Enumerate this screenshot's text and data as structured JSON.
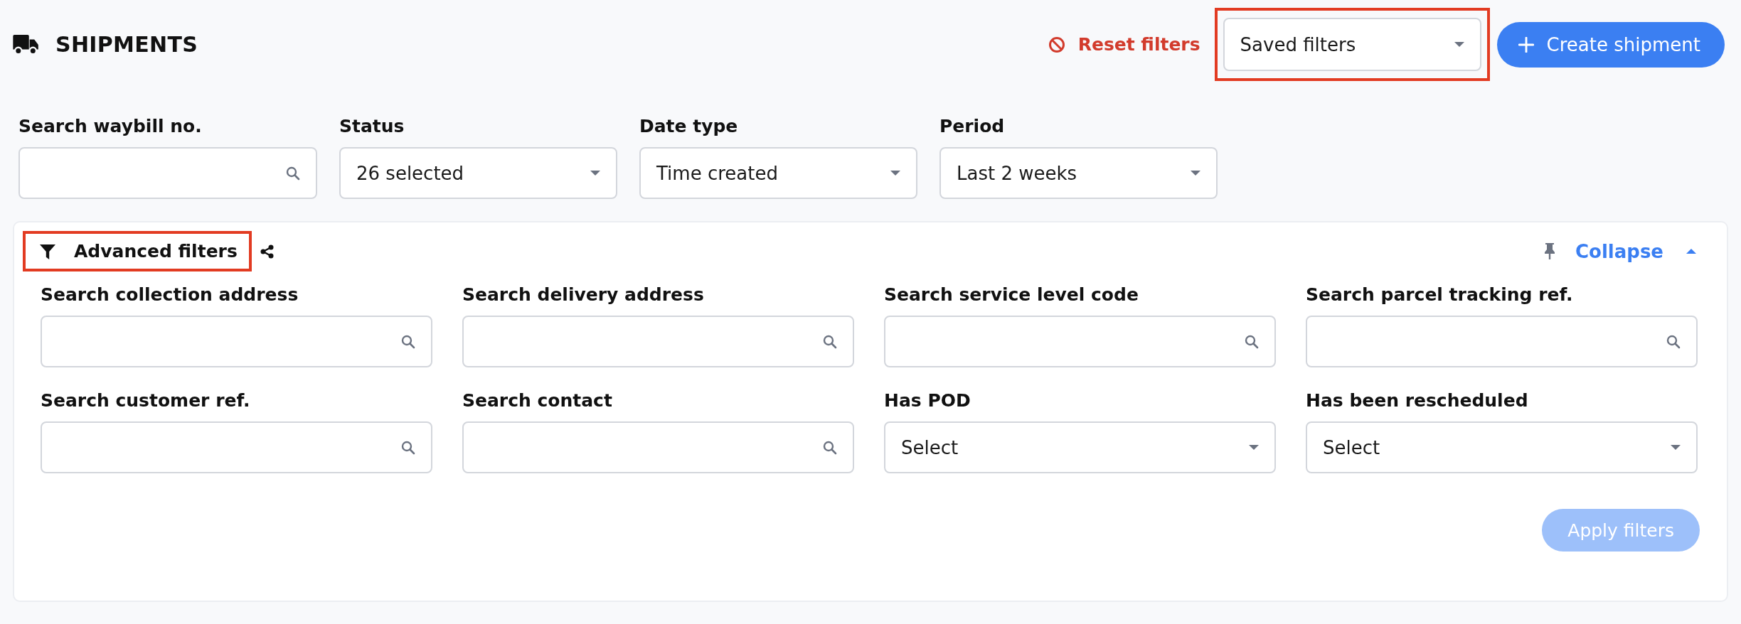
{
  "header": {
    "title": "SHIPMENTS",
    "reset_label": "Reset filters",
    "saved_filters": {
      "value": "Saved filters",
      "highlighted": true
    },
    "create_label": "Create shipment"
  },
  "filters": [
    {
      "kind": "search",
      "label": "Search waybill no."
    },
    {
      "kind": "select",
      "label": "Status",
      "value": "26 selected"
    },
    {
      "kind": "select",
      "label": "Date type",
      "value": "Time created"
    },
    {
      "kind": "select",
      "label": "Period",
      "value": "Last 2 weeks"
    }
  ],
  "advanced": {
    "title": "Advanced filters",
    "highlighted": true,
    "expanded": true,
    "toggle_label": "Collapse",
    "fields": [
      {
        "kind": "search",
        "label": "Search collection address"
      },
      {
        "kind": "search",
        "label": "Search delivery address"
      },
      {
        "kind": "search",
        "label": "Search service level code"
      },
      {
        "kind": "search",
        "label": "Search parcel tracking ref."
      },
      {
        "kind": "search",
        "label": "Search customer ref."
      },
      {
        "kind": "search",
        "label": "Search contact"
      },
      {
        "kind": "select",
        "label": "Has POD",
        "value": "Select"
      },
      {
        "kind": "select",
        "label": "Has been rescheduled",
        "value": "Select"
      }
    ],
    "apply_label": "Apply filters",
    "apply_disabled": true
  }
}
